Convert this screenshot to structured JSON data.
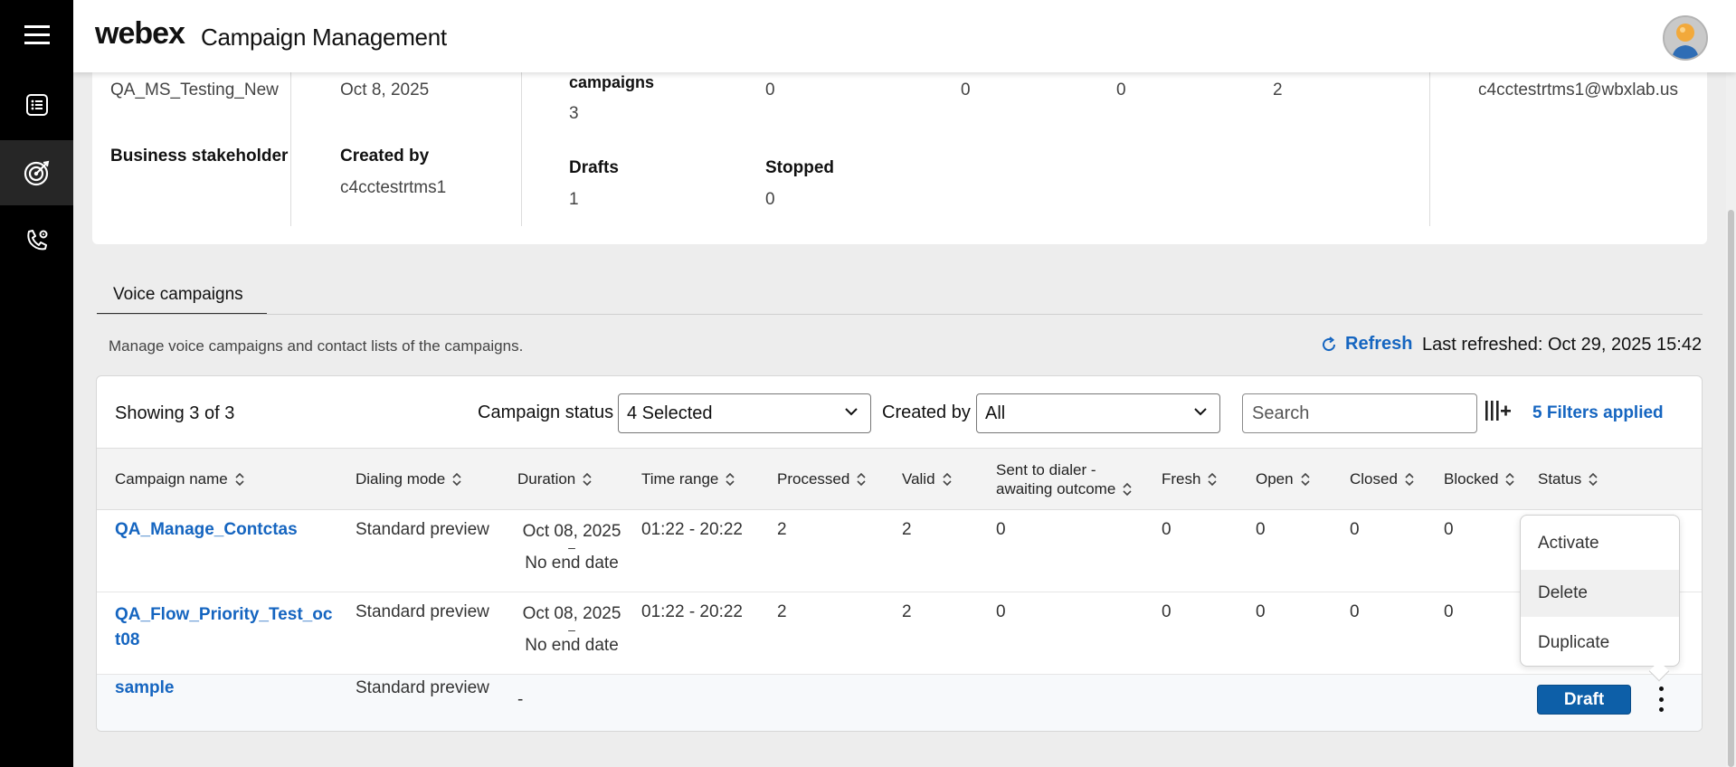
{
  "header": {
    "brand": "webex",
    "title": "Campaign Management"
  },
  "nav": {
    "items": [
      "menu-icon",
      "list-icon",
      "target-icon",
      "phone-settings-icon"
    ],
    "active": "target-icon"
  },
  "summary": {
    "campaign_name": "QA_MS_Testing_New",
    "date": "Oct 8, 2025",
    "campaigns_label": "campaigns",
    "campaigns_value": "3",
    "counts": [
      "0",
      "0",
      "0",
      "2"
    ],
    "owner_email": "c4cctestrtms1@wbxlab.us",
    "business_stakeholder_label": "Business stakeholder",
    "created_by_label": "Created by",
    "created_by_value": "c4cctestrtms1",
    "drafts_label": "Drafts",
    "drafts_value": "1",
    "stopped_label": "Stopped",
    "stopped_value": "0"
  },
  "tabs": {
    "active": "Voice campaigns"
  },
  "section": {
    "description": "Manage voice campaigns and contact lists of the campaigns.",
    "refresh_label": "Refresh",
    "last_refreshed": "Last refreshed: Oct 29, 2025 15:42"
  },
  "toolbar": {
    "showing": "Showing 3 of 3",
    "status_label": "Campaign status",
    "status_value": "4 Selected",
    "created_by_label": "Created by",
    "created_by_value": "All",
    "search_placeholder": "Search",
    "filters_applied": "5 Filters applied"
  },
  "table": {
    "columns": {
      "name": "Campaign name",
      "dialing": "Dialing mode",
      "duration": "Duration",
      "time_range": "Time range",
      "processed": "Processed",
      "valid": "Valid",
      "sent_line1": "Sent to dialer -",
      "sent_line2": "awaiting outcome",
      "fresh": "Fresh",
      "open": "Open",
      "closed": "Closed",
      "blocked": "Blocked",
      "status": "Status"
    },
    "rows": [
      {
        "name": "QA_Manage_Contctas",
        "dialing": "Standard preview",
        "dur_start": "Oct 08, 2025",
        "dur_sep": "–",
        "dur_end": "No end date",
        "time_range": "01:22 - 20:22",
        "processed": "2",
        "valid": "2",
        "sent": "0",
        "fresh": "0",
        "open": "0",
        "closed": "0",
        "blocked": "0"
      },
      {
        "name_line1": "QA_Flow_Priority_Test_oc",
        "name_line2": "t08",
        "dialing": "Standard preview",
        "dur_start": "Oct 08, 2025",
        "dur_sep": "–",
        "dur_end": "No end date",
        "time_range": "01:22 - 20:22",
        "processed": "2",
        "valid": "2",
        "sent": "0",
        "fresh": "0",
        "open": "0",
        "closed": "0",
        "blocked": "0"
      },
      {
        "name": "sample",
        "dialing": "Standard preview",
        "duration": "-",
        "status": "Draft"
      }
    ]
  },
  "menu": {
    "items": [
      "Activate",
      "Delete",
      "Duplicate"
    ],
    "hovered": "Delete"
  },
  "colors": {
    "accent": "#1565c0",
    "draft_button": "#0d5fa8",
    "nav_bg": "#000000"
  }
}
